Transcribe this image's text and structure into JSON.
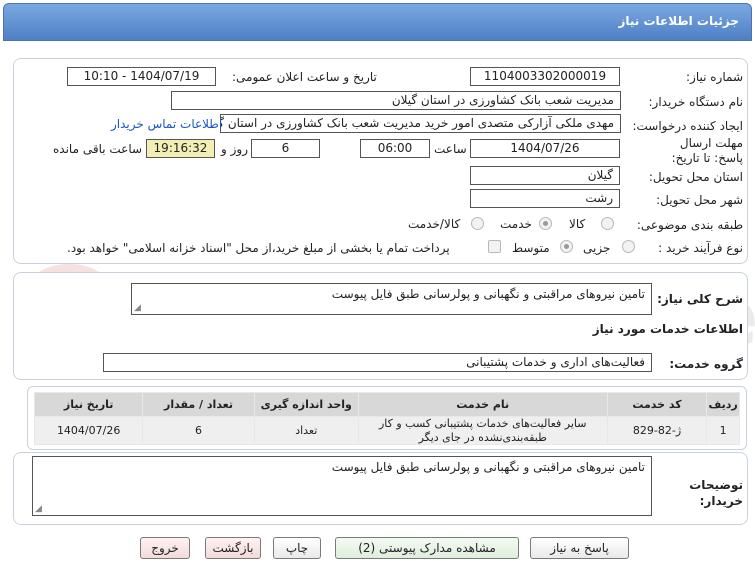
{
  "title": "جزئیات اطلاعات نیاز",
  "fields": {
    "need_number_label": "شماره نیاز:",
    "need_number": "1104003302000019",
    "announce_label": "تاریخ و ساعت اعلان عمومی:",
    "announce_value": "1404/07/19 - 10:10",
    "buyer_org_label": "نام دستگاه خریدار:",
    "buyer_org": "مدیریت شعب بانک کشاورزی در استان گیلان",
    "requester_label": "ایجاد کننده درخواست:",
    "requester": "مهدی ملکی آزارکی متصدی امور خرید مدیریت شعب بانک کشاورزی در استان گیلان",
    "contact_link": "اطلاعات تماس خریدار",
    "deadline_label": "مهلت ارسال پاسخ: تا تاریخ:",
    "deadline_date": "1404/07/26",
    "time_label": "ساعت",
    "deadline_time": "06:00",
    "days": "6",
    "days_label": "روز و",
    "remaining_time": "19:16:32",
    "remaining_label": "ساعت باقی مانده",
    "province_label": "استان محل تحویل:",
    "province": "گیلان",
    "city_label": "شهر محل تحویل:",
    "city": "رشت",
    "category_label": "طبقه بندی موضوعی:",
    "category_options": [
      "کالا",
      "خدمت",
      "کالا/خدمت"
    ],
    "purchase_type_label": "نوع فرآیند خرید :",
    "purchase_options": [
      "جزیی",
      "متوسط"
    ],
    "payment_note": "پرداخت تمام یا بخشی از مبلغ خرید،از محل \"اسناد خزانه اسلامی\" خواهد بود."
  },
  "general_desc_label": "شرح کلی نیاز:",
  "general_desc": "تامین نیروهای مراقبتی و نگهبانی و پولرسانی طبق فایل پیوست",
  "services_title": "اطلاعات خدمات مورد نیاز",
  "service_group_label": "گروه خدمت:",
  "service_group": "فعالیت‌های اداری و خدمات پشتیبانی",
  "table": {
    "headers": [
      "ردیف",
      "کد خدمت",
      "نام خدمت",
      "واحد اندازه گیری",
      "تعداد / مقدار",
      "تاریخ نیاز"
    ],
    "rows": [
      [
        "1",
        "ژ-82-829",
        "سایر فعالیت‌های خدمات پشتیبانی کسب و کار طبقه‌بندی‌نشده در جای دیگر",
        "تعداد",
        "6",
        "1404/07/26"
      ]
    ]
  },
  "buyer_notes_label": "توضیحات خریدار:",
  "buyer_notes": "تامین نیروهای مراقبتی و نگهبانی و پولرسانی طبق فایل پیوست",
  "buttons": {
    "reply": "پاسخ به نیاز",
    "view_docs": "مشاهده مدارک پیوستی (2)",
    "print": "چاپ",
    "back": "بازگشت",
    "exit": "خروج"
  },
  "watermark": "AriaTender.net",
  "colors": {
    "header": "#5a8bd0",
    "link": "#1a56c4",
    "remaining_bg": "#f2efb5"
  }
}
